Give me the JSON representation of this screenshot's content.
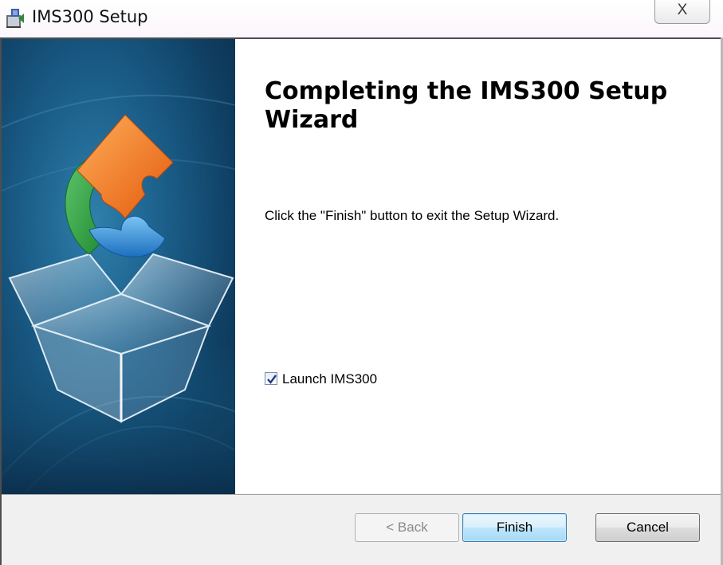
{
  "window": {
    "title": "IMS300 Setup",
    "close_glyph": "☒",
    "close_label": "X"
  },
  "content": {
    "heading": "Completing the IMS300 Setup Wizard",
    "description": "Click the \"Finish\" button to exit the Setup Wizard.",
    "launch_checkbox": {
      "label": "Launch IMS300",
      "checked": true
    }
  },
  "buttons": {
    "back": "< Back",
    "finish": "Finish",
    "cancel": "Cancel"
  },
  "icons": {
    "app": "installer-icon",
    "banner": "puzzle-box-graphic"
  }
}
